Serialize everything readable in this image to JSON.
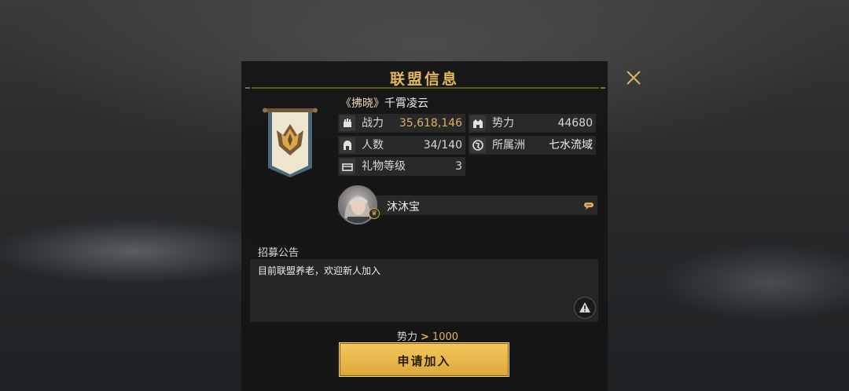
{
  "dialog": {
    "title": "联盟信息",
    "close_icon": "close-icon"
  },
  "alliance": {
    "tag": "《拂晓》",
    "name": "千霄凌云",
    "banner_icon": "alliance-banner-emblem"
  },
  "stats": {
    "power": {
      "label": "战力",
      "value": "35,618,146",
      "icon": "fist-icon"
    },
    "influence": {
      "label": "势力",
      "value": "44680",
      "icon": "castle-icon"
    },
    "members": {
      "label": "人数",
      "value": "34/140",
      "icon": "helmet-icon"
    },
    "continent": {
      "label": "所属洲",
      "value": "七水流域",
      "icon": "globe-icon"
    },
    "gift_level": {
      "label": "礼物等级",
      "value": "3",
      "icon": "gift-icon"
    }
  },
  "leader": {
    "name": "沐沐宝",
    "badge_icon": "crown-icon",
    "chat_icon": "chat-bubble-icon"
  },
  "recruitment": {
    "label": "招募公告",
    "text": "目前联盟养老，欢迎新人加入",
    "report_icon": "warning-icon"
  },
  "requirement": {
    "label": "势力",
    "arrow": ">",
    "value": "1000"
  },
  "apply_button": {
    "label": "申请加入"
  },
  "colors": {
    "accent_gold": "#e0b15a",
    "button_gold": "#e8b648",
    "panel_bg": "#161616",
    "text_light": "#d9d7d0"
  }
}
